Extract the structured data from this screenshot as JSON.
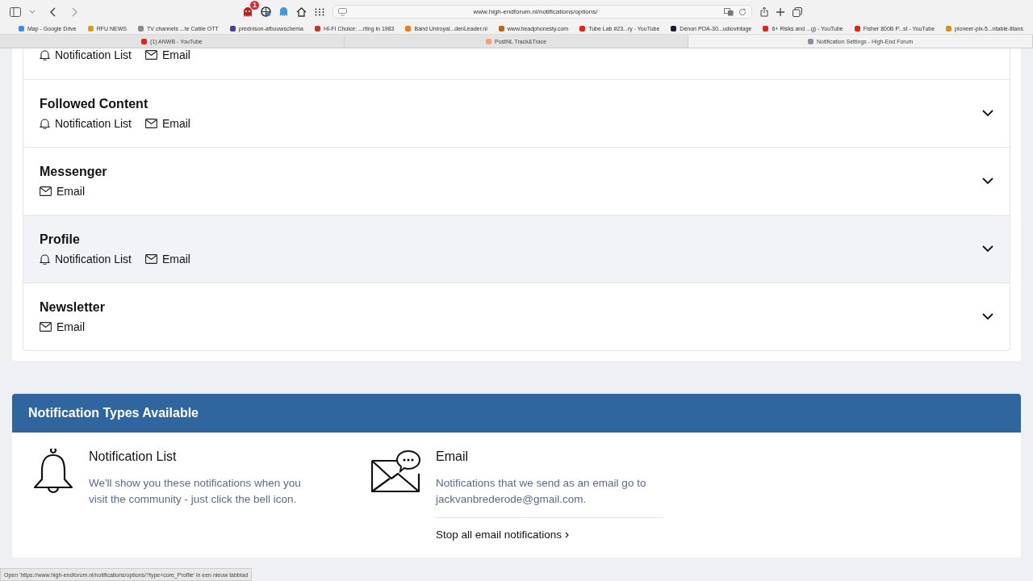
{
  "browser": {
    "url": "www.high-endforum.nl/notifications/options/",
    "extension_badge": "1",
    "bookmarks": [
      {
        "label": "Map - Google Drive",
        "color": "#4285f4"
      },
      {
        "label": "RFU NEWS",
        "color": "#d4a017"
      },
      {
        "label": "TV channels ...te Cable OTT",
        "color": "#8a8a8a"
      },
      {
        "label": "prednison-afbouwschema",
        "color": "#4b3aa8"
      },
      {
        "label": "HI-FI Choice: ...rting in 1983",
        "color": "#c0392b"
      },
      {
        "label": "Band Uniroyal...denLeader.nl",
        "color": "#f07a1a"
      },
      {
        "label": "www.headphonesty.com",
        "color": "#b5651d"
      },
      {
        "label": "Tube Lab #23...ry - YouTube",
        "color": "#e62117"
      },
      {
        "label": "Denon POA-30...udiovintage",
        "color": "#1a1a2e"
      },
      {
        "label": "6+ Risks and ...g) - YouTube",
        "color": "#e62117"
      },
      {
        "label": "Fisher 800B P...st - YouTube",
        "color": "#e62117"
      },
      {
        "label": "pioneer-plx-5...ntable-titans",
        "color": "#c8961e"
      }
    ],
    "tabs": [
      {
        "label": "(1) ANWB - YouTube",
        "selected": false,
        "color": "#e62117"
      },
      {
        "label": "PostNL Track&Trace",
        "selected": false,
        "color": "#f0a080"
      },
      {
        "label": "Notification Settings - High-End Forum",
        "selected": true,
        "color": "#8a8fa0"
      }
    ]
  },
  "categories": [
    {
      "types": [
        {
          "kind": "list",
          "label": "Notification List"
        },
        {
          "kind": "email",
          "label": "Email"
        }
      ],
      "hovered": false
    },
    {
      "title": "Followed Content",
      "types": [
        {
          "kind": "list",
          "label": "Notification List"
        },
        {
          "kind": "email",
          "label": "Email"
        }
      ],
      "hovered": false
    },
    {
      "title": "Messenger",
      "types": [
        {
          "kind": "email",
          "label": "Email"
        }
      ],
      "hovered": false
    },
    {
      "title": "Profile",
      "types": [
        {
          "kind": "list",
          "label": "Notification List"
        },
        {
          "kind": "email",
          "label": "Email"
        }
      ],
      "hovered": true
    },
    {
      "title": "Newsletter",
      "types": [
        {
          "kind": "email",
          "label": "Email"
        }
      ],
      "hovered": false
    }
  ],
  "types_panel": {
    "title": "Notification Types Available",
    "items": [
      {
        "kind": "list",
        "title": "Notification List",
        "description": "We'll show you these notifications when you visit the community - just click the bell icon."
      },
      {
        "kind": "email",
        "title": "Email",
        "description": "Notifications that we send as an email go to jackvanbrederode@gmail.com.",
        "link": "Stop all email notifications"
      }
    ]
  },
  "status_bar": "Open 'https://www.high-endforum.nl/notifications/options/?type=core_Profile' in een nieuw tabblad"
}
